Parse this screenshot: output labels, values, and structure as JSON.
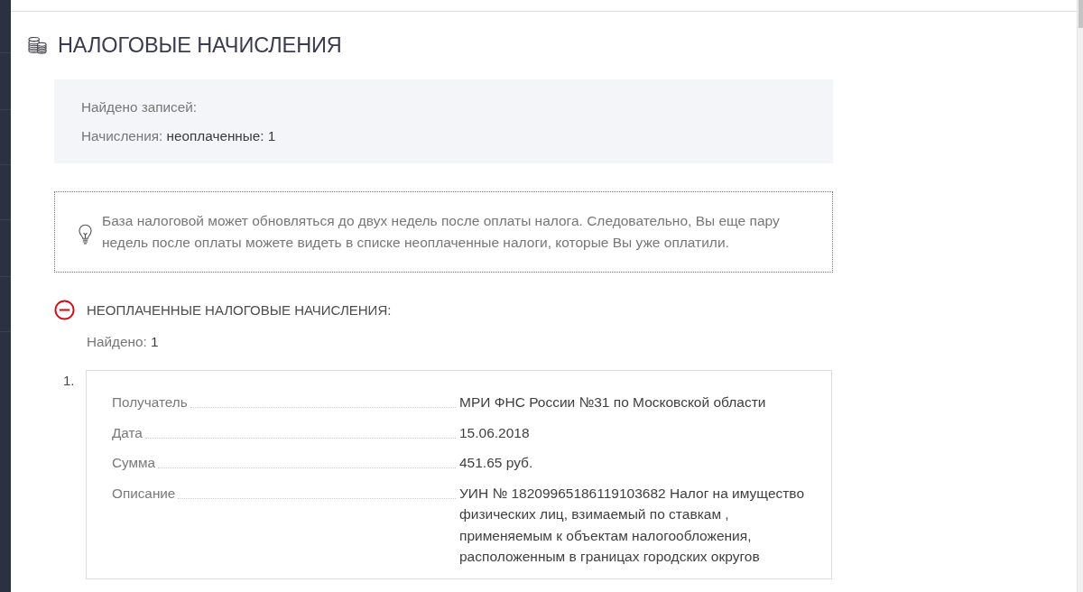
{
  "page": {
    "title": "НАЛОГОВЫЕ НАЧИСЛЕНИЯ"
  },
  "summary": {
    "found_label": "Найдено записей:",
    "charges": "Начисления: **неоплаченные: 1**"
  },
  "notice": {
    "text": "База налоговой может обновляться до двух недель после оплаты налога. Следовательно, Вы еще пару недель после оплаты можете видеть в списке неоплаченные налоги, которые Вы уже оплатили."
  },
  "section": {
    "title": "НЕОПЛАЧЕННЫЕ НАЛОГОВЫЕ НАЧИСЛЕНИЯ:",
    "expanded": true,
    "found": "Найдено: **1**",
    "items": [
      {
        "number": "1.",
        "fields": [
          {
            "label": "Получатель",
            "value": "МРИ ФНС России №31 по Московской области"
          },
          {
            "label": "Дата",
            "value": "15.06.2018"
          },
          {
            "label": "Сумма",
            "value": "451.65 руб."
          },
          {
            "label": "Описание",
            "value": "УИН № 18209965186119103682 Налог на имущество физических лиц, взимаемый по ставкам , применяемым к объектам налогообложения, расположенным в границах городских округов"
          }
        ]
      }
    ]
  }
}
